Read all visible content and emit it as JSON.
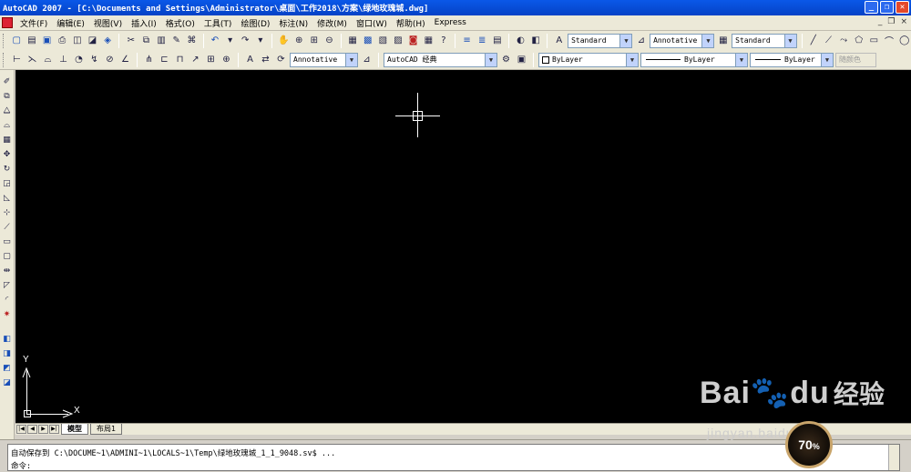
{
  "window": {
    "title": "AutoCAD 2007 - [C:\\Documents and Settings\\Administrator\\桌面\\工作2018\\方案\\绿地玫瑰城.dwg]",
    "minimize": "_",
    "restore": "❐",
    "close": "✕"
  },
  "menubar": {
    "items": [
      "文件(F)",
      "编辑(E)",
      "视图(V)",
      "插入(I)",
      "格式(O)",
      "工具(T)",
      "绘图(D)",
      "标注(N)",
      "修改(M)",
      "窗口(W)",
      "帮助(H)",
      "Express"
    ],
    "doc_min": "_",
    "doc_restore": "❐",
    "doc_close": "×"
  },
  "toolbar1": {
    "text_style": "Standard",
    "dim_style": "Annotative",
    "table_style": "Standard"
  },
  "toolbar2": {
    "annotation_scale": "Annotative",
    "workspace": "AutoCAD 经典",
    "color": "ByLayer",
    "linetype": "ByLayer",
    "lineweight": "ByLayer",
    "plot_style": "随颜色"
  },
  "ucs": {
    "x_label": "X",
    "y_label": "Y"
  },
  "tabs": {
    "nav": [
      "|◀",
      "◀",
      "▶",
      "▶|"
    ],
    "items": [
      "模型",
      "布局1"
    ]
  },
  "command": {
    "history": "自动保存到 C:\\DOCUME~1\\ADMINI~1\\LOCALS~1\\Temp\\绿地玫瑰城_1_1_9048.sv$ ...",
    "prompt": "命令:"
  },
  "watermark": {
    "brand": "Bai",
    "brand_end": "du",
    "cn": "经验",
    "url": "jingyan.baidu.com"
  },
  "overlay_badge": {
    "value": "70",
    "unit": "%"
  },
  "colors": {
    "titlebar": "#0a58e8",
    "canvas": "#000000",
    "toolbar_bg": "#ece9d8"
  }
}
